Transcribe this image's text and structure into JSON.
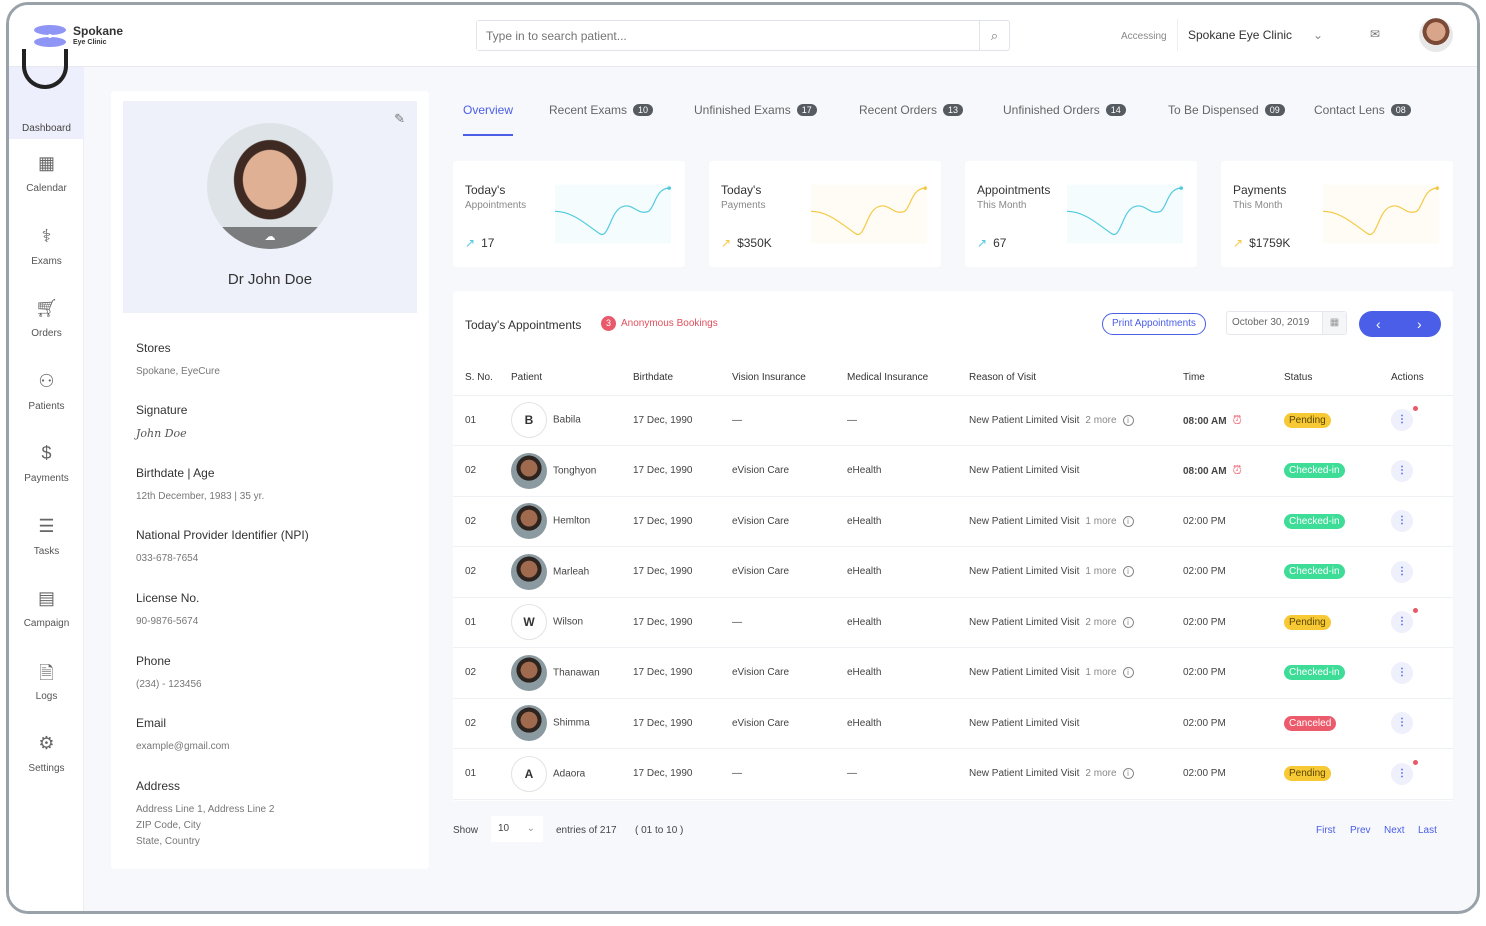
{
  "brand": {
    "name": "Spokane",
    "sub": "Eye Clinic"
  },
  "search": {
    "placeholder": "Type in to search patient..."
  },
  "header": {
    "accessing": "Accessing",
    "clinic": "Spokane Eye Clinic"
  },
  "sidebar": {
    "items": [
      {
        "label": "Dashboard",
        "icon": "dashboard-icon"
      },
      {
        "label": "Calendar",
        "icon": "calendar-icon"
      },
      {
        "label": "Exams",
        "icon": "stethoscope-icon"
      },
      {
        "label": "Orders",
        "icon": "cart-icon"
      },
      {
        "label": "Patients",
        "icon": "patients-icon"
      },
      {
        "label": "Payments",
        "icon": "dollar-icon"
      },
      {
        "label": "Tasks",
        "icon": "tasks-icon"
      },
      {
        "label": "Campaign",
        "icon": "campaign-icon"
      },
      {
        "label": "Logs",
        "icon": "logs-icon"
      },
      {
        "label": "Settings",
        "icon": "gear-icon"
      }
    ]
  },
  "profile": {
    "name": "Dr John Doe",
    "fields": [
      {
        "label": "Stores",
        "value": "Spokane, EyeCure"
      },
      {
        "label": "Signature",
        "value": "John Doe"
      },
      {
        "label": "Birthdate | Age",
        "value": "12th December, 1983   |   35 yr."
      },
      {
        "label": "National Provider Identifier (NPI)",
        "value": "033-678-7654"
      },
      {
        "label": "License No.",
        "value": "90-9876-5674"
      },
      {
        "label": "Phone",
        "value": "(234) - 123456"
      },
      {
        "label": "Email",
        "value": "example@gmail.com"
      },
      {
        "label": "Address",
        "value": "Address Line 1, Address Line 2\nZIP Code, City\nState, Country"
      }
    ]
  },
  "tabs": [
    {
      "label": "Overview",
      "active": true
    },
    {
      "label": "Recent Exams",
      "count": "10"
    },
    {
      "label": "Unfinished Exams",
      "count": "17"
    },
    {
      "label": "Recent Orders",
      "count": "13"
    },
    {
      "label": "Unfinished Orders",
      "count": "14"
    },
    {
      "label": "To Be Dispensed",
      "count": "09"
    },
    {
      "label": "Contact Lens",
      "count": "08"
    }
  ],
  "stats": [
    {
      "title": "Today's",
      "sub": "Appointments",
      "value": "17",
      "color": "#4ec9e0"
    },
    {
      "title": "Today's",
      "sub": "Payments",
      "value": "$350K",
      "color": "#f5c842"
    },
    {
      "title": "Appointments",
      "sub": "This Month",
      "value": "67",
      "color": "#4ec9e0"
    },
    {
      "title": "Payments",
      "sub": "This Month",
      "value": "$1759K",
      "color": "#f5c842"
    }
  ],
  "appointments": {
    "title": "Today's Appointments",
    "anon_count": "3",
    "anon_label": "Anonymous Bookings",
    "print": "Print Appointments",
    "date": "October 30, 2019",
    "columns": [
      "S. No.",
      "Patient",
      "Birthdate",
      "Vision Insurance",
      "Medical Insurance",
      "Reason of Visit",
      "Time",
      "Status",
      "Actions"
    ],
    "rows": [
      {
        "no": "01",
        "initial": "B",
        "name": "Babila",
        "birth": "17 Dec, 1990",
        "vision": "—",
        "medical": "—",
        "reason": "New Patient Limited Visit",
        "more": "2 more",
        "time": "08:00 AM",
        "alarm": true,
        "status": "Pending",
        "notify": true
      },
      {
        "no": "02",
        "initial": "",
        "name": "Tonghyon",
        "birth": "17 Dec, 1990",
        "vision": "eVision Care",
        "medical": "eHealth",
        "reason": "New Patient Limited Visit",
        "more": "",
        "time": "08:00 AM",
        "alarm": true,
        "status": "Checked-in",
        "notify": false
      },
      {
        "no": "02",
        "initial": "",
        "name": "Hemlton",
        "birth": "17 Dec, 1990",
        "vision": "eVision Care",
        "medical": "eHealth",
        "reason": "New Patient Limited Visit",
        "more": "1 more",
        "time": "02:00 PM",
        "alarm": false,
        "status": "Checked-in",
        "notify": false
      },
      {
        "no": "02",
        "initial": "",
        "name": "Marleah",
        "birth": "17 Dec, 1990",
        "vision": "eVision Care",
        "medical": "eHealth",
        "reason": "New Patient Limited Visit",
        "more": "1 more",
        "time": "02:00 PM",
        "alarm": false,
        "status": "Checked-in",
        "notify": false
      },
      {
        "no": "01",
        "initial": "W",
        "name": "Wilson",
        "birth": "17 Dec, 1990",
        "vision": "—",
        "medical": "eHealth",
        "reason": "New Patient Limited Visit",
        "more": "2 more",
        "time": "02:00 PM",
        "alarm": false,
        "status": "Pending",
        "notify": true
      },
      {
        "no": "02",
        "initial": "",
        "name": "Thanawan",
        "birth": "17 Dec, 1990",
        "vision": "eVision Care",
        "medical": "eHealth",
        "reason": "New Patient Limited Visit",
        "more": "1 more",
        "time": "02:00 PM",
        "alarm": false,
        "status": "Checked-in",
        "notify": false
      },
      {
        "no": "02",
        "initial": "",
        "name": "Shimma",
        "birth": "17 Dec, 1990",
        "vision": "eVision Care",
        "medical": "eHealth",
        "reason": "New Patient Limited Visit",
        "more": "",
        "time": "02:00 PM",
        "alarm": false,
        "status": "Canceled",
        "notify": false
      },
      {
        "no": "01",
        "initial": "A",
        "name": "Adaora",
        "birth": "17 Dec, 1990",
        "vision": "—",
        "medical": "—",
        "reason": "New Patient Limited Visit",
        "more": "2 more",
        "time": "02:00 PM",
        "alarm": false,
        "status": "Pending",
        "notify": true
      }
    ]
  },
  "status_colors": {
    "Pending": "#f7c934",
    "Checked-in": "#3ddc97",
    "Canceled": "#ec5b6b"
  },
  "footer": {
    "show": "Show",
    "per_page": "10",
    "entries": "entries of 217",
    "range": "( 01 to 10 )",
    "pages": [
      "First",
      "Prev",
      "Next",
      "Last"
    ]
  }
}
